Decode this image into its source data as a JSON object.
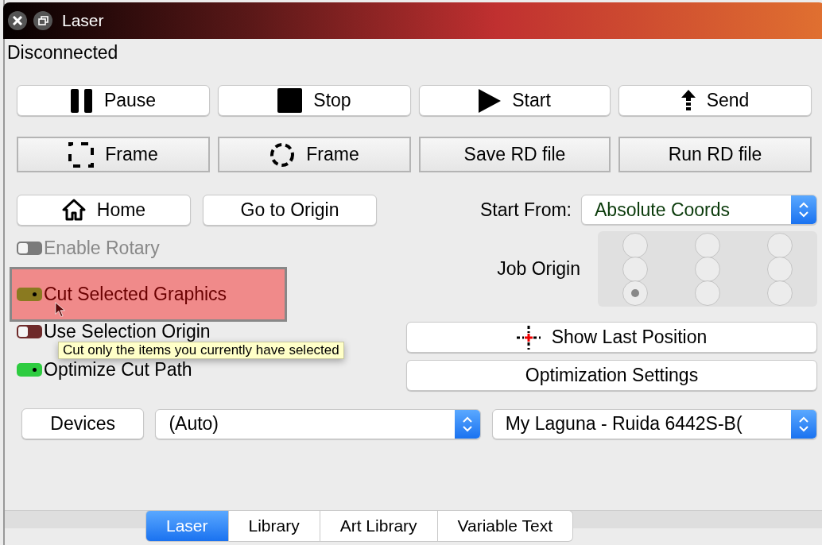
{
  "window": {
    "title": "Laser"
  },
  "status": "Disconnected",
  "control_buttons": [
    {
      "kind": "pause",
      "label": "Pause"
    },
    {
      "kind": "stop",
      "label": "Stop"
    },
    {
      "kind": "start",
      "label": "Start"
    },
    {
      "kind": "send",
      "label": "Send"
    }
  ],
  "file_buttons": [
    {
      "kind": "frame-rect",
      "label": "Frame"
    },
    {
      "kind": "frame-circle",
      "label": "Frame"
    },
    {
      "kind": "plain",
      "label": "Save RD file"
    },
    {
      "kind": "plain",
      "label": "Run RD file"
    }
  ],
  "nav_buttons": [
    {
      "kind": "home",
      "label": "Home"
    },
    {
      "kind": "plain",
      "label": "Go to Origin"
    }
  ],
  "start_from": {
    "label": "Start From:",
    "value": "Absolute Coords"
  },
  "job_origin": {
    "label": "Job Origin",
    "points": [
      {
        "selected": false
      },
      {
        "selected": false
      },
      {
        "selected": false
      },
      {
        "selected": false
      },
      {
        "selected": false
      },
      {
        "selected": false
      },
      {
        "selected": true
      },
      {
        "selected": false
      },
      {
        "selected": false
      }
    ]
  },
  "options": [
    {
      "label": "Enable Rotary",
      "checked": false,
      "disabled": true,
      "highlighted": false
    },
    {
      "label": "Cut Selected Graphics",
      "checked": true,
      "disabled": false,
      "highlighted": true
    },
    {
      "label": "Use Selection Origin",
      "checked": false,
      "disabled": false,
      "highlighted": false
    },
    {
      "label": "Optimize Cut Path",
      "checked": true,
      "disabled": false,
      "highlighted": false
    }
  ],
  "tooltip": "Cut only the items you currently have selected",
  "side_buttons": [
    {
      "kind": "crosshair",
      "label": "Show Last Position"
    },
    {
      "kind": "plain",
      "label": "Optimization Settings"
    }
  ],
  "devices": {
    "button": "Devices",
    "port": "(Auto)",
    "device": "My Laguna - Ruida 6442S-B("
  },
  "tabs": [
    {
      "label": "Laser",
      "selected": true
    },
    {
      "label": "Library",
      "selected": false
    },
    {
      "label": "Art Library",
      "selected": false
    },
    {
      "label": "Variable Text",
      "selected": false
    }
  ]
}
